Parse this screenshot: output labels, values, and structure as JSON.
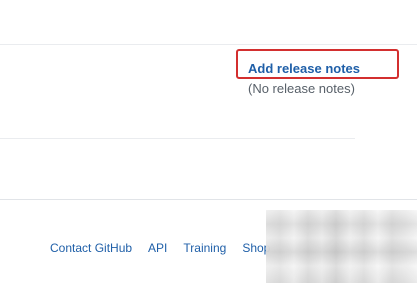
{
  "release": {
    "add_link_label": "Add release notes",
    "empty_text": "(No release notes)",
    "highlight_color": "#d32f2f"
  },
  "footer": {
    "links": [
      "Contact GitHub",
      "API",
      "Training",
      "Shop"
    ]
  },
  "colors": {
    "link": "#1f5fa8",
    "muted": "#586069"
  }
}
